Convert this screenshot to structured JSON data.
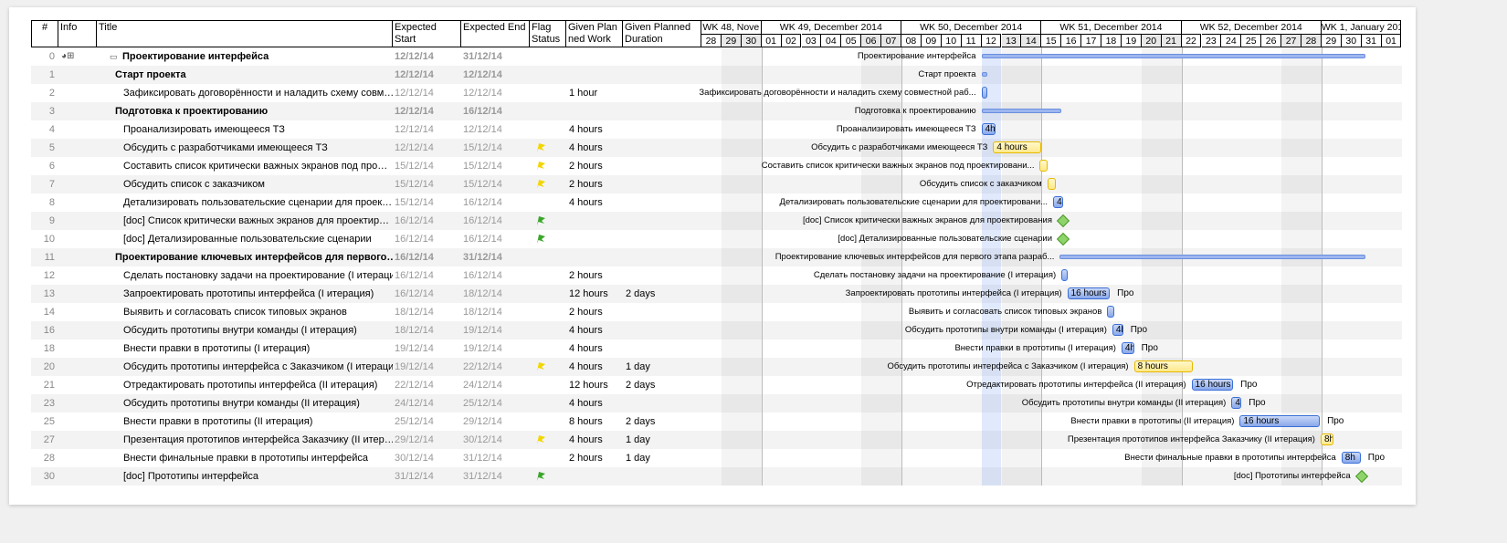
{
  "columns": {
    "num": "#",
    "info": "Info",
    "title": "Title",
    "start": "Expected Start",
    "end": "Expected End",
    "flag": "Flag Status",
    "work": "Given Plan ned Work",
    "duration": "Given Planned Duration"
  },
  "weeks": [
    "WK 48, Nove",
    "WK 49, December 2014",
    "WK 50, December 2014",
    "WK 51, December 2014",
    "WK 52, December 2014",
    "WK 1, January 201"
  ],
  "days": [
    "28",
    "29",
    "30",
    "01",
    "02",
    "03",
    "04",
    "05",
    "06",
    "07",
    "08",
    "09",
    "10",
    "11",
    "12",
    "13",
    "14",
    "15",
    "16",
    "17",
    "18",
    "19",
    "20",
    "21",
    "22",
    "23",
    "24",
    "25",
    "26",
    "27",
    "28",
    "29",
    "30",
    "31",
    "01"
  ],
  "today": "12",
  "colors": {
    "flag_yellow": "#f2d600",
    "flag_green": "#3aa62a",
    "bar_blue": "#8aa8ea",
    "bar_yellow": "#ffe98a",
    "milestone": "#8fd46a"
  },
  "tasks": [
    {
      "id": "0",
      "level": 0,
      "title": "Проектирование интерфейса",
      "start": "12/12/14",
      "end": "31/12/14",
      "flag": "",
      "work": "",
      "duration": "",
      "summary": true,
      "chart_label": "Проектирование интерфейса",
      "bar": {
        "kind": "summary",
        "from": "2014-12-12T00:00",
        "to": "2014-12-31T05:00"
      }
    },
    {
      "id": "1",
      "level": 1,
      "title": "Старт проекта",
      "start": "12/12/14",
      "end": "12/12/14",
      "flag": "",
      "work": "",
      "duration": "",
      "summary": true,
      "chart_label": "Старт проекта",
      "bar": {
        "kind": "summary",
        "from": "2014-12-12T00:00",
        "to": "2014-12-12T06:00"
      }
    },
    {
      "id": "2",
      "level": 2,
      "title": "Зафиксировать договорённости и наладить схему совм…",
      "start": "12/12/14",
      "end": "12/12/14",
      "flag": "",
      "work": "1 hour",
      "duration": "",
      "chart_label": "Зафиксировать договорённости и наладить схему совместной раб...",
      "bar": {
        "kind": "blue",
        "from": "2014-12-12T00:00",
        "to": "2014-12-12T03:00",
        "text": ""
      }
    },
    {
      "id": "3",
      "level": 1,
      "title": "Подготовка к проектированию",
      "start": "12/12/14",
      "end": "16/12/14",
      "flag": "",
      "work": "",
      "duration": "",
      "summary": true,
      "chart_label": "Подготовка к проектированию",
      "bar": {
        "kind": "summary",
        "from": "2014-12-12T00:00",
        "to": "2014-12-16T00:00"
      }
    },
    {
      "id": "4",
      "level": 2,
      "title": "Проанализировать имеющееся ТЗ",
      "start": "12/12/14",
      "end": "12/12/14",
      "flag": "",
      "work": "4 hours",
      "duration": "",
      "chart_label": "Проанализировать имеющееся ТЗ",
      "bar": {
        "kind": "blue",
        "from": "2014-12-12T00:00",
        "to": "2014-12-12T17:00",
        "text": "4h"
      }
    },
    {
      "id": "5",
      "level": 2,
      "title": "Обсудить с разработчиками имеющееся ТЗ",
      "start": "12/12/14",
      "end": "15/12/14",
      "flag": "yellow",
      "work": "4 hours",
      "duration": "",
      "chart_label": "Обсудить с разработчиками имеющееся ТЗ",
      "bar": {
        "kind": "yellow",
        "from": "2014-12-12T14:00",
        "to": "2014-12-15T00:00",
        "text": "4 hours"
      }
    },
    {
      "id": "6",
      "level": 2,
      "title": "Составить список критически важных экранов под про…",
      "start": "15/12/14",
      "end": "15/12/14",
      "flag": "yellow",
      "work": "2 hours",
      "duration": "",
      "chart_label": "Составить список критически важных экранов под проектировани...",
      "bar": {
        "kind": "yellow",
        "from": "2014-12-14T22:00",
        "to": "2014-12-15T07:00",
        "text": ""
      }
    },
    {
      "id": "7",
      "level": 2,
      "title": "Обсудить список с заказчиком",
      "start": "15/12/14",
      "end": "15/12/14",
      "flag": "yellow",
      "work": "2 hours",
      "duration": "",
      "chart_label": "Обсудить список с заказчиком",
      "bar": {
        "kind": "yellow",
        "from": "2014-12-15T07:00",
        "to": "2014-12-15T17:00",
        "text": ""
      }
    },
    {
      "id": "8",
      "level": 2,
      "title": "Детализировать пользовательские сценарии для проек…",
      "start": "15/12/14",
      "end": "16/12/14",
      "flag": "",
      "work": "4 hours",
      "duration": "",
      "chart_label": "Детализировать пользовательские сценарии для проектировани...",
      "bar": {
        "kind": "blue",
        "from": "2014-12-15T14:00",
        "to": "2014-12-16T02:00",
        "text": "4l"
      }
    },
    {
      "id": "9",
      "level": 2,
      "title": "[doc] Список критически важных экранов для проектир…",
      "start": "16/12/14",
      "end": "16/12/14",
      "flag": "green",
      "work": "",
      "duration": "",
      "chart_label": "[doc] Список критически важных экранов для проектирования",
      "bar": {
        "kind": "milestone",
        "from": "2014-12-16T02:00",
        "to": "2014-12-16T02:00"
      }
    },
    {
      "id": "10",
      "level": 2,
      "title": "[doc] Детализированные пользовательские сценарии",
      "start": "16/12/14",
      "end": "16/12/14",
      "flag": "green",
      "work": "",
      "duration": "",
      "chart_label": "[doc] Детализированные пользовательские сценарии",
      "bar": {
        "kind": "milestone",
        "from": "2014-12-16T02:00",
        "to": "2014-12-16T02:00"
      }
    },
    {
      "id": "11",
      "level": 1,
      "title": "Проектирование ключевых интерфейсов для первого…",
      "start": "16/12/14",
      "end": "31/12/14",
      "flag": "",
      "work": "",
      "duration": "",
      "summary": true,
      "chart_label": "Проектирование ключевых интерфейсов для первого этапа разраб...",
      "bar": {
        "kind": "summary",
        "from": "2014-12-15T22:00",
        "to": "2014-12-31T05:00"
      }
    },
    {
      "id": "12",
      "level": 2,
      "title": "Сделать постановку задачи на проектирование  (I итерация)",
      "start": "16/12/14",
      "end": "16/12/14",
      "flag": "",
      "work": "2 hours",
      "duration": "",
      "chart_label": "Сделать постановку задачи на проектирование  (I итерация)",
      "bar": {
        "kind": "blue",
        "from": "2014-12-16T00:00",
        "to": "2014-12-16T07:00",
        "text": ""
      }
    },
    {
      "id": "13",
      "level": 2,
      "title": "Запроектировать прототипы интерфейса (I итерация)",
      "start": "16/12/14",
      "end": "18/12/14",
      "flag": "",
      "work": "12 hours",
      "duration": "2 days",
      "chart_label": "Запроектировать прототипы интерфейса (I итерация)",
      "bar": {
        "kind": "blue",
        "from": "2014-12-16T07:00",
        "to": "2014-12-18T10:00",
        "text": "16 hours",
        "after": "Про"
      }
    },
    {
      "id": "14",
      "level": 2,
      "title": "Выявить и согласовать список типовых экранов",
      "start": "18/12/14",
      "end": "18/12/14",
      "flag": "",
      "work": "2 hours",
      "duration": "",
      "chart_label": "Выявить и согласовать список типовых экранов",
      "bar": {
        "kind": "blue",
        "from": "2014-12-18T07:00",
        "to": "2014-12-18T15:00",
        "text": ""
      }
    },
    {
      "id": "16",
      "level": 2,
      "title": "Обсудить прототипы внутри команды  (I итерация)",
      "start": "18/12/14",
      "end": "19/12/14",
      "flag": "",
      "work": "4 hours",
      "duration": "",
      "chart_label": "Обсудить прототипы внутри команды  (I итерация)",
      "bar": {
        "kind": "blue",
        "from": "2014-12-18T13:00",
        "to": "2014-12-19T02:00",
        "text": "4l",
        "after": "Про"
      }
    },
    {
      "id": "18",
      "level": 2,
      "title": "Внести правки в прототипы  (I итерация)",
      "start": "19/12/14",
      "end": "19/12/14",
      "flag": "",
      "work": "4 hours",
      "duration": "",
      "chart_label": "Внести правки в прототипы  (I итерация)",
      "bar": {
        "kind": "blue",
        "from": "2014-12-19T00:00",
        "to": "2014-12-19T15:00",
        "text": "4h",
        "after": "Про"
      }
    },
    {
      "id": "20",
      "level": 2,
      "title": "Обсудить прототипы интерфейса с Заказчиком (I итерация)",
      "start": "19/12/14",
      "end": "22/12/14",
      "flag": "yellow",
      "work": "4 hours",
      "duration": "1 day",
      "chart_label": "Обсудить прототипы интерфейса с Заказчиком (I итерация)",
      "bar": {
        "kind": "yellow",
        "from": "2014-12-19T15:00",
        "to": "2014-12-22T14:00",
        "text": "8 hours"
      }
    },
    {
      "id": "21",
      "level": 2,
      "title": "Отредактировать прототипы интерфейса (II итерация)",
      "start": "22/12/14",
      "end": "24/12/14",
      "flag": "",
      "work": "12 hours",
      "duration": "2 days",
      "chart_label": "Отредактировать прототипы интерфейса (II итерация)",
      "bar": {
        "kind": "blue",
        "from": "2014-12-22T12:00",
        "to": "2014-12-24T14:00",
        "text": "16 hours",
        "after": "Про"
      }
    },
    {
      "id": "23",
      "level": 2,
      "title": "Обсудить прототипы внутри команды  (II итерация)",
      "start": "24/12/14",
      "end": "25/12/14",
      "flag": "",
      "work": "4 hours",
      "duration": "",
      "chart_label": "Обсудить прототипы внутри команды  (II итерация)",
      "bar": {
        "kind": "blue",
        "from": "2014-12-24T12:00",
        "to": "2014-12-25T00:00",
        "text": "4l",
        "after": "Про"
      }
    },
    {
      "id": "25",
      "level": 2,
      "title": "Внести правки в прототипы (II итерация)",
      "start": "25/12/14",
      "end": "29/12/14",
      "flag": "",
      "work": "8 hours",
      "duration": "2 days",
      "chart_label": "Внести правки в прототипы (II итерация)",
      "bar": {
        "kind": "blue",
        "from": "2014-12-24T22:00",
        "to": "2014-12-28T22:00",
        "text": "16 hours",
        "after": "Про"
      }
    },
    {
      "id": "27",
      "level": 2,
      "title": "Презентация прототипов интерфейса Заказчику (II итер…",
      "start": "29/12/14",
      "end": "30/12/14",
      "flag": "yellow",
      "work": "4 hours",
      "duration": "1 day",
      "chart_label": "Презентация прототипов интерфейса Заказчику (II итерация)",
      "bar": {
        "kind": "yellow",
        "from": "2014-12-28T23:00",
        "to": "2014-12-29T14:00",
        "text": "8h"
      }
    },
    {
      "id": "28",
      "level": 2,
      "title": "Внести финальные правки в прототипы интерфейса",
      "start": "30/12/14",
      "end": "31/12/14",
      "flag": "",
      "work": "2 hours",
      "duration": "1 day",
      "chart_label": "Внести финальные правки в прототипы интерфейса",
      "bar": {
        "kind": "blue",
        "from": "2014-12-30T00:00",
        "to": "2014-12-30T23:00",
        "text": "8h",
        "after": "Про"
      }
    },
    {
      "id": "30",
      "level": 2,
      "title": "[doc] Прототипы интерфейса",
      "start": "31/12/14",
      "end": "31/12/14",
      "flag": "green",
      "work": "",
      "duration": "",
      "chart_label": "[doc] Прототипы интерфейса",
      "bar": {
        "kind": "milestone",
        "from": "2014-12-31T00:00",
        "to": "2014-12-31T00:00"
      }
    }
  ]
}
